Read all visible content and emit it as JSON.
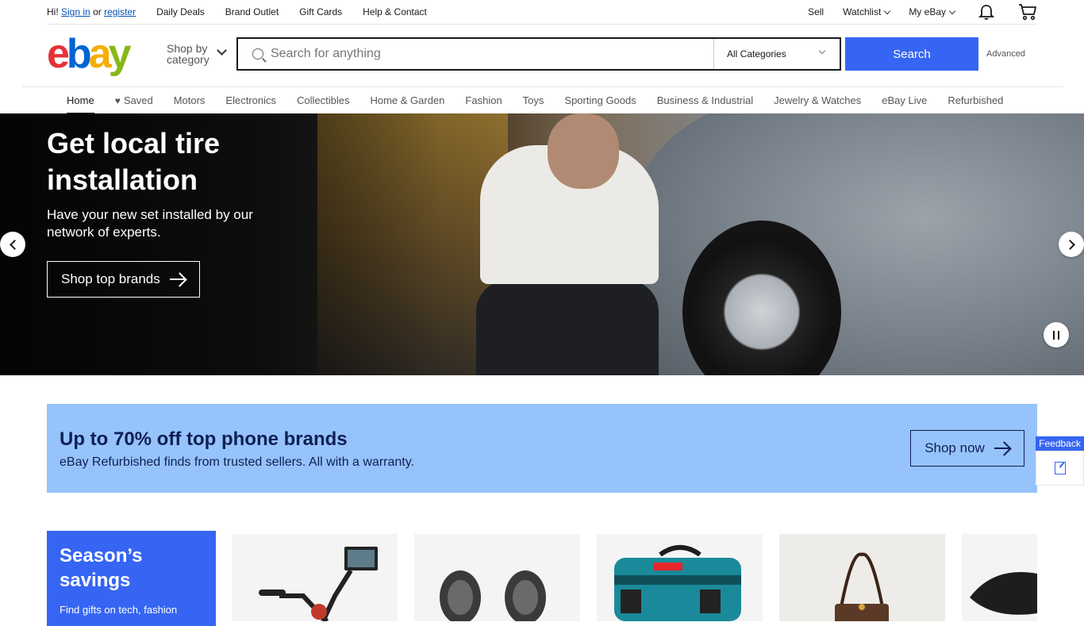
{
  "topbar": {
    "greeting_prefix": "Hi!",
    "sign_in": "Sign in",
    "or": "or",
    "register": "register",
    "links": [
      "Daily Deals",
      "Brand Outlet",
      "Gift Cards",
      "Help & Contact"
    ],
    "sell": "Sell",
    "watchlist": "Watchlist",
    "myebay": "My eBay"
  },
  "header": {
    "logo": {
      "e": "e",
      "b": "b",
      "a": "a",
      "y": "y"
    },
    "shop_by_line1": "Shop by",
    "shop_by_line2": "category",
    "search_placeholder": "Search for anything",
    "category_selected": "All Categories",
    "search_button": "Search",
    "advanced": "Advanced"
  },
  "nav": {
    "items": [
      "Home",
      "Saved",
      "Motors",
      "Electronics",
      "Collectibles",
      "Home & Garden",
      "Fashion",
      "Toys",
      "Sporting Goods",
      "Business & Industrial",
      "Jewelry & Watches",
      "eBay Live",
      "Refurbished"
    ]
  },
  "hero": {
    "title": "Get local tire installation",
    "subtitle": "Have your new set installed by our network of experts.",
    "button": "Shop top brands"
  },
  "promo": {
    "title": "Up to 70% off top phone brands",
    "subtitle": "eBay Refurbished finds from trusted sellers. All with a warranty.",
    "button": "Shop now"
  },
  "feedback": {
    "label": "Feedback"
  },
  "savings": {
    "title": "Season’s savings",
    "subtitle": "Find gifts on tech, fashion"
  },
  "colors": {
    "accent": "#3665f3",
    "promo_bg": "#96c3fc",
    "promo_text": "#0f2054"
  }
}
